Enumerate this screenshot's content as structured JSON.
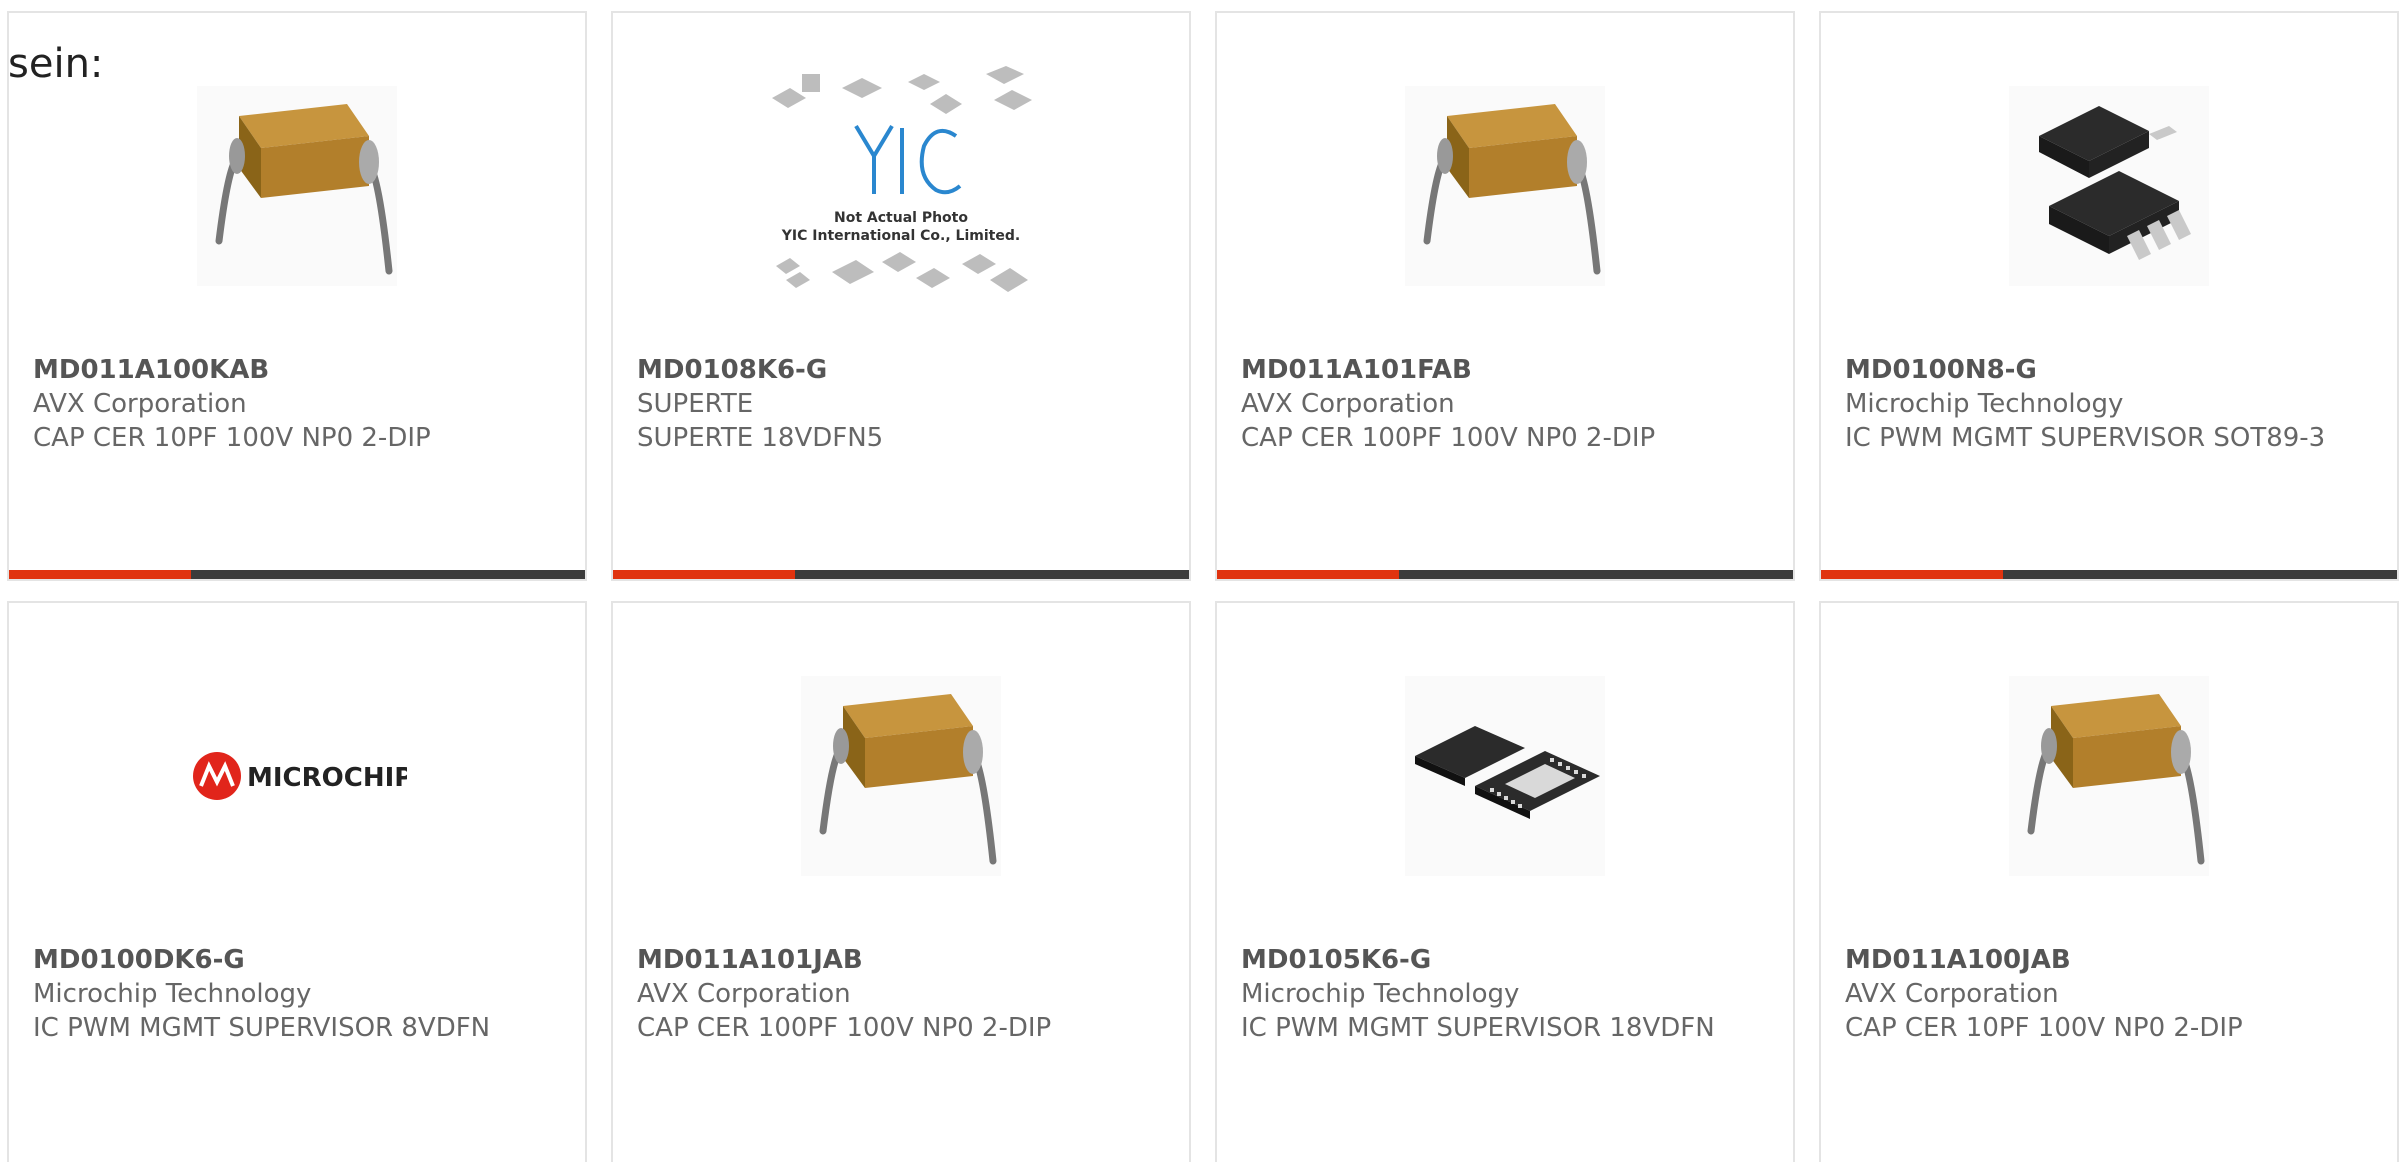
{
  "intro_text": "sein:",
  "colors": {
    "accent": "#e0330f",
    "bar_dark": "#3b3b3b",
    "border": "#e4e4e4",
    "text": "#666666"
  },
  "products": [
    {
      "part_number": "MD011A100KAB",
      "manufacturer": "AVX Corporation",
      "description": "CAP CER 10PF 100V NP0 2-DIP",
      "image": "radial-capacitor-image"
    },
    {
      "part_number": "MD0108K6-G",
      "manufacturer": "SUPERTE",
      "description": "SUPERTE 18VDFN5",
      "image": "yic-placeholder-image",
      "placeholder_line1": "Not Actual Photo",
      "placeholder_line2": "YIC International Co., Limited."
    },
    {
      "part_number": "MD011A101FAB",
      "manufacturer": "AVX Corporation",
      "description": "CAP CER 100PF 100V NP0 2-DIP",
      "image": "radial-capacitor-image"
    },
    {
      "part_number": "MD0100N8-G",
      "manufacturer": "Microchip Technology",
      "description": "IC PWM MGMT SUPERVISOR SOT89-3",
      "image": "sot89-package-image"
    },
    {
      "part_number": "MD0100DK6-G",
      "manufacturer": "Microchip Technology",
      "description": "IC PWM MGMT SUPERVISOR 8VDFN",
      "image": "microchip-logo-image",
      "logo_text": "MICROCHIP"
    },
    {
      "part_number": "MD011A101JAB",
      "manufacturer": "AVX Corporation",
      "description": "CAP CER 100PF 100V NP0 2-DIP",
      "image": "radial-capacitor-image"
    },
    {
      "part_number": "MD0105K6-G",
      "manufacturer": "Microchip Technology",
      "description": "IC PWM MGMT SUPERVISOR 18VDFN",
      "image": "dfn-package-image"
    },
    {
      "part_number": "MD011A100JAB",
      "manufacturer": "AVX Corporation",
      "description": "CAP CER 10PF 100V NP0 2-DIP",
      "image": "radial-capacitor-image"
    }
  ]
}
